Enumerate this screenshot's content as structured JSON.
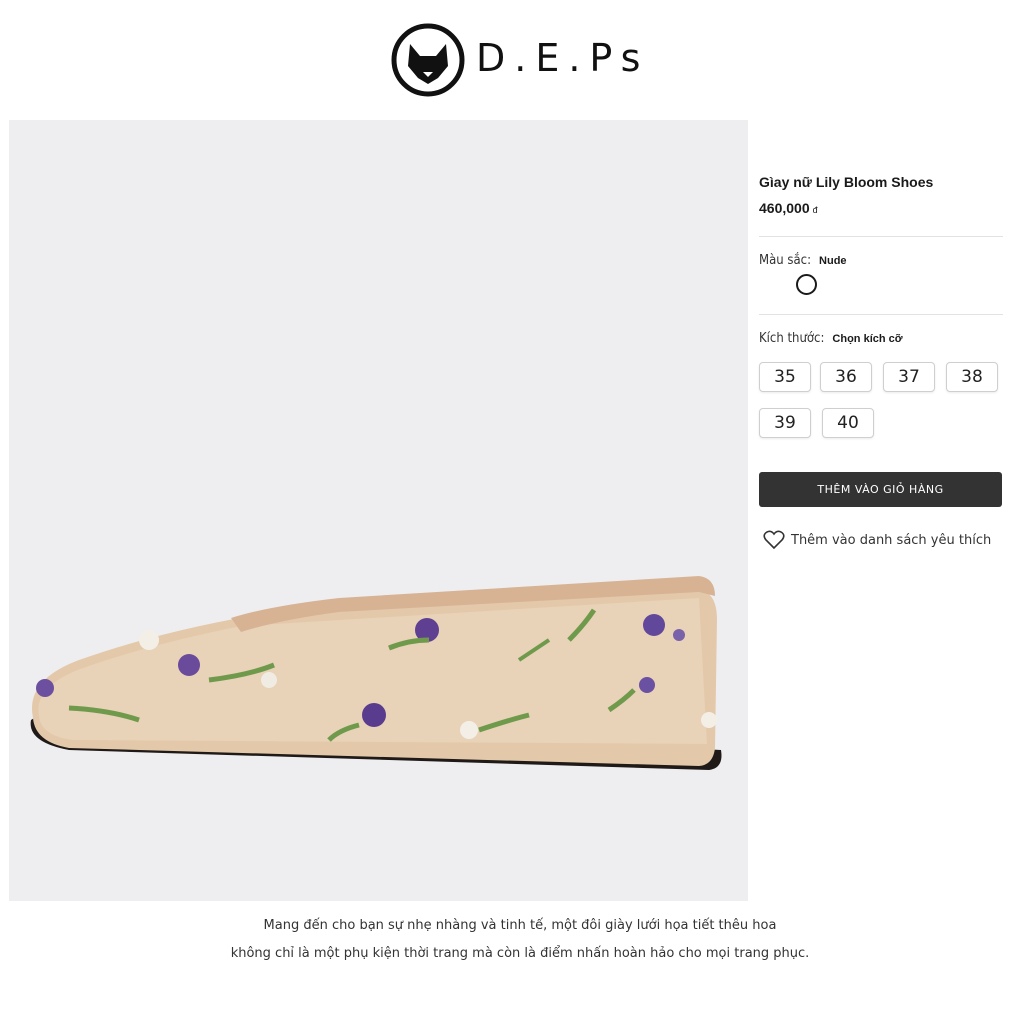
{
  "brand": {
    "name": "D.E.Ps",
    "logo_icon": "fox-face-icon"
  },
  "product": {
    "name": "Gìay nữ Lily Bloom Shoes",
    "price": "460,000",
    "currency": "đ",
    "image_icon": "embroidered-mesh-flat-shoe",
    "colors": {
      "primary": "#333333",
      "image_bg": "#eeeef1"
    }
  },
  "color_option": {
    "label": "Màu sắc:",
    "value": "Nude",
    "swatch_icon": "swatch-circle-icon"
  },
  "size_option": {
    "label": "Kích thước:",
    "value": "Chọn kích cỡ",
    "sizes": [
      "35",
      "36",
      "37",
      "38",
      "39",
      "40"
    ]
  },
  "actions": {
    "add_to_cart": "THÊM VÀO GIỎ HÀNG",
    "wishlist": "Thêm vào danh sách yêu thích",
    "wishlist_icon": "heart-icon"
  },
  "description": {
    "line1": "Mang đến cho bạn sự nhẹ nhàng và tinh tế, một đôi giày lưới họa tiết thêu hoa",
    "line2": "không chỉ là một phụ kiện thời trang mà còn là điểm nhấn hoàn hảo cho mọi trang phục."
  }
}
